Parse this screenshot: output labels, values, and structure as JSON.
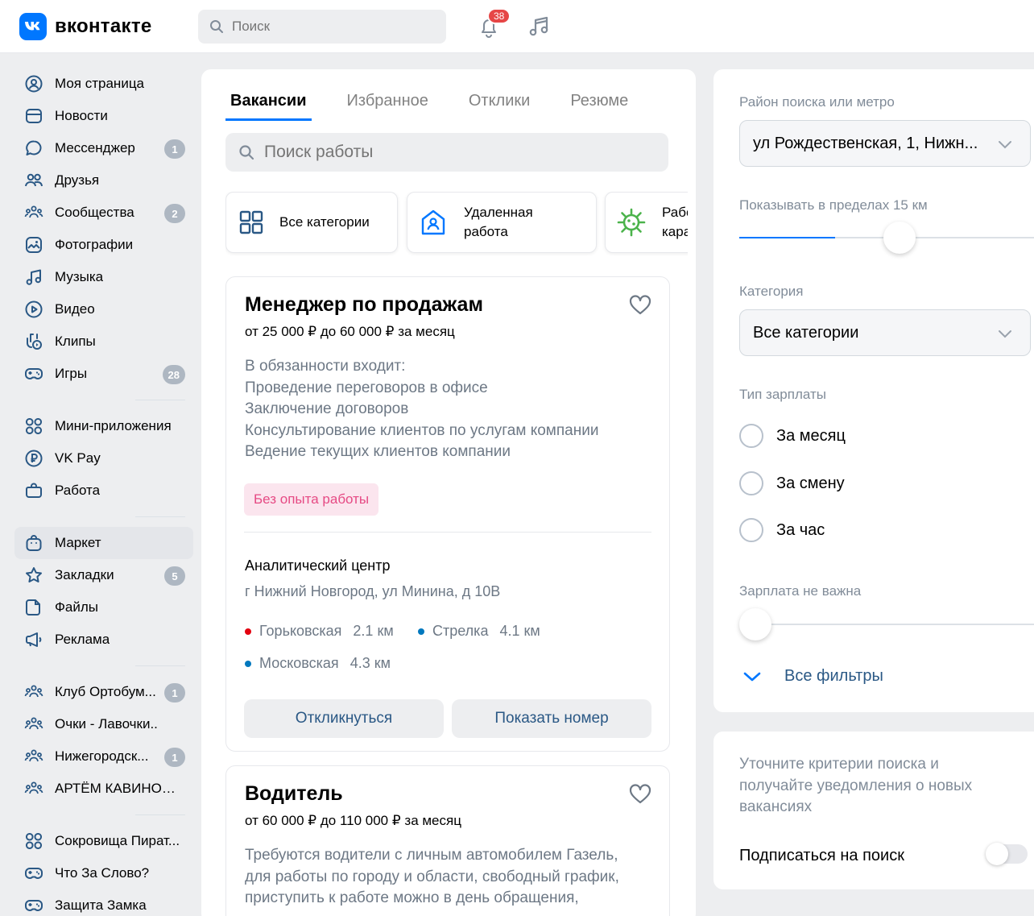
{
  "header": {
    "logo_mark": "vk",
    "logo_text": "вконтакте",
    "search_placeholder": "Поиск",
    "notifications_count": "38"
  },
  "sidebar": {
    "items": [
      {
        "label": "Моя страница",
        "icon": "user-circle-icon",
        "badge": ""
      },
      {
        "label": "Новости",
        "icon": "news-icon",
        "badge": ""
      },
      {
        "label": "Мессенджер",
        "icon": "message-icon",
        "badge": "1"
      },
      {
        "label": "Друзья",
        "icon": "friends-icon",
        "badge": ""
      },
      {
        "label": "Сообщества",
        "icon": "communities-icon",
        "badge": "2"
      },
      {
        "label": "Фотографии",
        "icon": "photo-icon",
        "badge": ""
      },
      {
        "label": "Музыка",
        "icon": "music-icon",
        "badge": ""
      },
      {
        "label": "Видео",
        "icon": "video-icon",
        "badge": ""
      },
      {
        "label": "Клипы",
        "icon": "clips-icon",
        "badge": ""
      },
      {
        "label": "Игры",
        "icon": "gamepad-icon",
        "badge": "28"
      }
    ],
    "apps": [
      {
        "label": "Мини-приложения",
        "icon": "apps-icon",
        "badge": ""
      },
      {
        "label": "VK Pay",
        "icon": "vkpay-icon",
        "badge": ""
      },
      {
        "label": "Работа",
        "icon": "briefcase-icon",
        "badge": ""
      }
    ],
    "more": [
      {
        "label": "Маркет",
        "icon": "market-icon",
        "badge": ""
      },
      {
        "label": "Закладки",
        "icon": "star-icon",
        "badge": "5"
      },
      {
        "label": "Файлы",
        "icon": "file-icon",
        "badge": ""
      },
      {
        "label": "Реклама",
        "icon": "megaphone-icon",
        "badge": ""
      }
    ],
    "groups": [
      {
        "label": "Клуб Ортобум...",
        "icon": "communities-icon",
        "badge": "1"
      },
      {
        "label": "Очки - Лавочки..",
        "icon": "communities-icon",
        "badge": ""
      },
      {
        "label": "Нижегородск...",
        "icon": "communities-icon",
        "badge": "1"
      },
      {
        "label": "АРТЁМ КАВИНОВ ...",
        "icon": "communities-icon",
        "badge": ""
      }
    ],
    "games": [
      {
        "label": "Сокровища Пират...",
        "icon": "apps-icon",
        "badge": ""
      },
      {
        "label": "Что За Слово?",
        "icon": "gamepad-icon",
        "badge": ""
      },
      {
        "label": "Защита Замка",
        "icon": "gamepad-icon",
        "badge": ""
      }
    ]
  },
  "center": {
    "tabs": [
      "Вакансии",
      "Избранное",
      "Отклики",
      "Резюме"
    ],
    "search_placeholder": "Поиск работы",
    "categories": [
      {
        "label": "Все категории",
        "icon": "grid-icon"
      },
      {
        "label": "Удаленная работа",
        "icon": "remote-house-icon"
      },
      {
        "label": "Работа на карантине",
        "icon": "virus-icon"
      }
    ],
    "jobs": [
      {
        "title": "Менеджер по продажам",
        "salary": "от 25 000 ₽ до 60 000 ₽ за месяц",
        "description": [
          "В обязанности входит:",
          "Проведение переговоров в офисе",
          "Заключение договоров",
          "Консультирование клиентов по услугам компании",
          "Ведение текущих клиентов компании"
        ],
        "tag": "Без опыта работы",
        "company": "Аналитический центр",
        "address": "г Нижний Новгород, ул Минина, д 10В",
        "metro": [
          {
            "name": "Горьковская",
            "distance": "2.1 км",
            "color": "#e3000f"
          },
          {
            "name": "Стрелка",
            "distance": "4.1 км",
            "color": "#0078be"
          },
          {
            "name": "Московская",
            "distance": "4.3 км",
            "color": "#0078be"
          }
        ],
        "respond_label": "Откликнуться",
        "phone_label": "Показать номер"
      },
      {
        "title": "Водитель",
        "salary": "от 60 000 ₽ до 110 000 ₽ за месяц",
        "description": [
          "Требуются водители с личным автомобилем Газель,",
          "для работы по городу и области, свободный график,",
          "приступить к работе можно в день обращения,"
        ]
      }
    ]
  },
  "filters": {
    "district_label": "Район поиска или метро",
    "district_value": "ул Рождественская, 1, Нижн...",
    "radius_label": "Показывать в пределах 15 км",
    "radius_fraction": 0.26,
    "category_label": "Категория",
    "category_value": "Все категории",
    "salary_type_label": "Тип зарплаты",
    "salary_types": [
      "За месяц",
      "За смену",
      "За час"
    ],
    "salary_label": "Зарплата не важна",
    "salary_fraction": 0.0,
    "all_filters_label": "Все фильтры"
  },
  "subscribe": {
    "text": "Уточните критерии поиска и получайте уведомления о новых вакансиях",
    "label": "Подписаться на поиск",
    "enabled": false
  },
  "colors": {
    "accent": "#0077ff",
    "link": "#2a5885",
    "badge_red": "#e64646",
    "tag_pink": "#e64a84"
  }
}
